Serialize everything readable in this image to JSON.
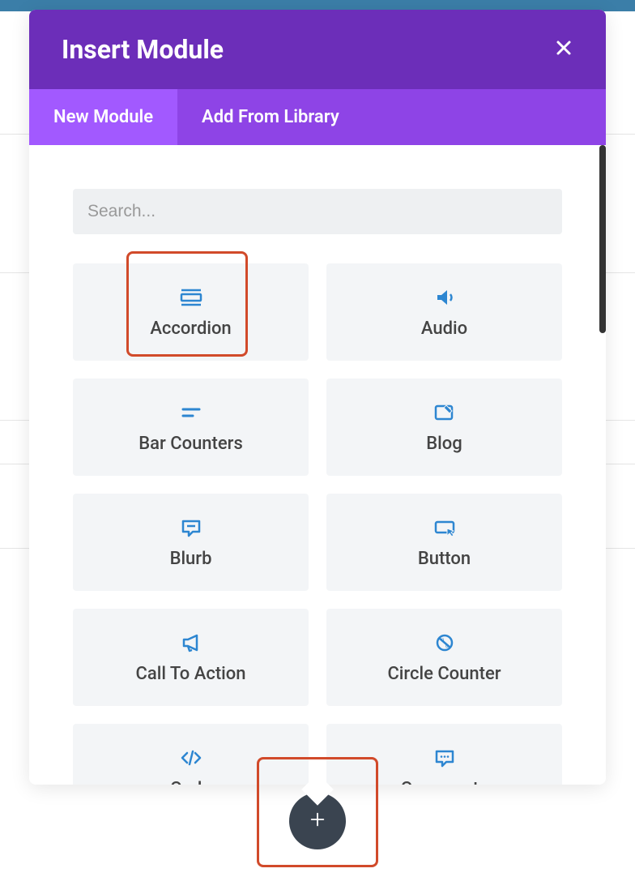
{
  "header": {
    "title": "Insert Module"
  },
  "tabs": {
    "new_module": "New Module",
    "add_from_library": "Add From Library"
  },
  "search": {
    "placeholder": "Search..."
  },
  "modules": {
    "accordion": {
      "label": "Accordion",
      "icon": "accordion-icon"
    },
    "audio": {
      "label": "Audio",
      "icon": "audio-icon"
    },
    "bar_counters": {
      "label": "Bar Counters",
      "icon": "bar-counters-icon"
    },
    "blog": {
      "label": "Blog",
      "icon": "blog-icon"
    },
    "blurb": {
      "label": "Blurb",
      "icon": "blurb-icon"
    },
    "button": {
      "label": "Button",
      "icon": "button-icon"
    },
    "call_to_action": {
      "label": "Call To Action",
      "icon": "call-to-action-icon"
    },
    "circle_counter": {
      "label": "Circle Counter",
      "icon": "circle-counter-icon"
    },
    "code": {
      "label": "Code",
      "icon": "code-icon"
    },
    "comments": {
      "label": "Comments",
      "icon": "comments-icon"
    }
  },
  "colors": {
    "accent": "#2d86d1",
    "header_bg": "#6c2eb9",
    "tabs_bg": "#8e44e6",
    "tab_active_bg": "#a259ff",
    "highlight": "#d14a2a",
    "fab_bg": "#3a4450"
  }
}
